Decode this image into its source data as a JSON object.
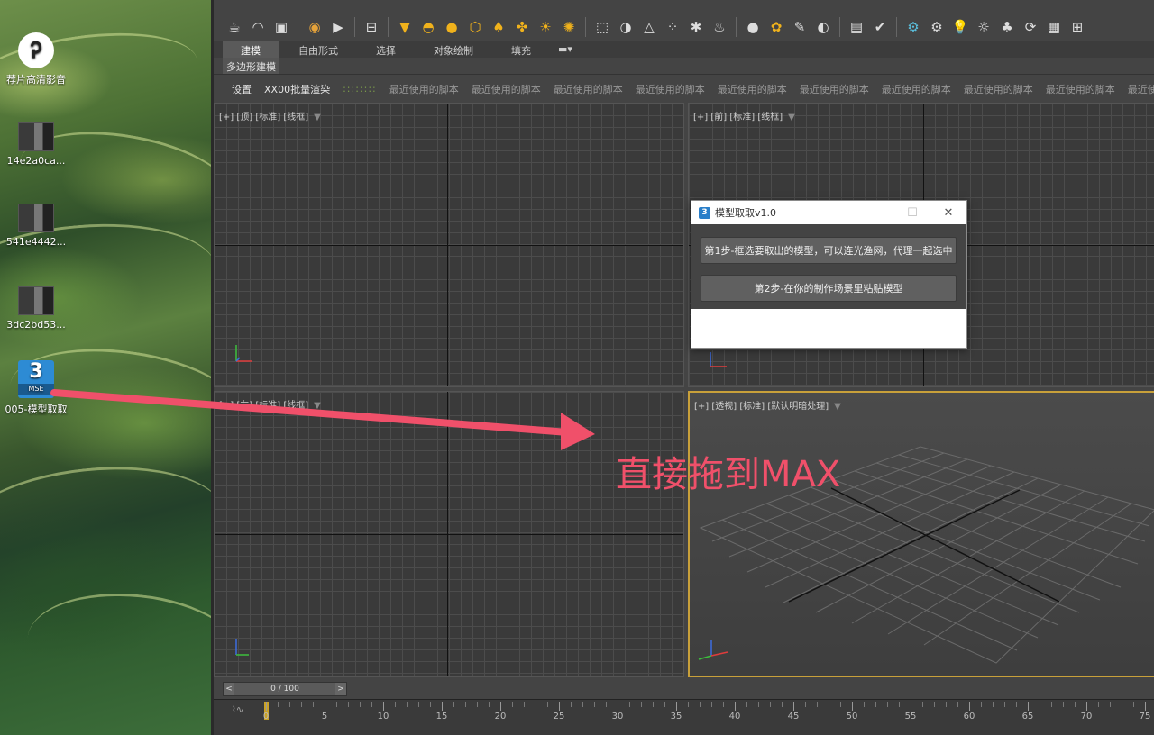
{
  "desktop": {
    "icons": [
      {
        "label": "荐片高清影音",
        "icon": "jianpian-app-icon"
      },
      {
        "label": "14e2a0ca...",
        "icon": "image-thumbnail-icon"
      },
      {
        "label": "541e4442...",
        "icon": "image-thumbnail-icon"
      },
      {
        "label": "3dc2bd53...",
        "icon": "image-thumbnail-icon"
      },
      {
        "label": "005-模型取取",
        "icon": "maxscript-mse-icon"
      }
    ],
    "mse_badge_number": "3",
    "mse_badge_text": "MSE"
  },
  "ribbon": {
    "tabs": [
      "建模",
      "自由形式",
      "选择",
      "对象绘制",
      "填充"
    ],
    "active_tab": "建模",
    "sub_panel": "多边形建模",
    "scripts_bar": {
      "settings": "设置",
      "batch_render": "XX00批量渲染",
      "dots": "::::::::",
      "recent_script": "最近使用的脚本"
    }
  },
  "viewports": {
    "top": {
      "label": "[+] [顶] [标准] [线框]"
    },
    "front": {
      "label": "[+] [前] [标准] [线框]"
    },
    "left": {
      "label": "[+] [左] [标准] [线框]"
    },
    "persp": {
      "label": "[+] [透视] [标准] [默认明暗处理]"
    }
  },
  "timeslider": {
    "value": "0 / 100",
    "prev": "<",
    "next": ">"
  },
  "timeline": {
    "ticks": [
      0,
      5,
      10,
      15,
      20,
      25,
      30,
      35,
      40,
      45,
      50,
      55,
      60,
      65,
      70,
      75
    ]
  },
  "dialog": {
    "title": "模型取取v1.0",
    "app_icon": "3",
    "minimize": "—",
    "maximize": "☐",
    "close": "✕",
    "step1": "第1步-框选要取出的模型，可以连光渔网，代理一起选中",
    "step2": "第2步-在你的制作场景里粘贴模型"
  },
  "annotation": {
    "text": "直接拖到MAX",
    "color": "#f0506a"
  }
}
